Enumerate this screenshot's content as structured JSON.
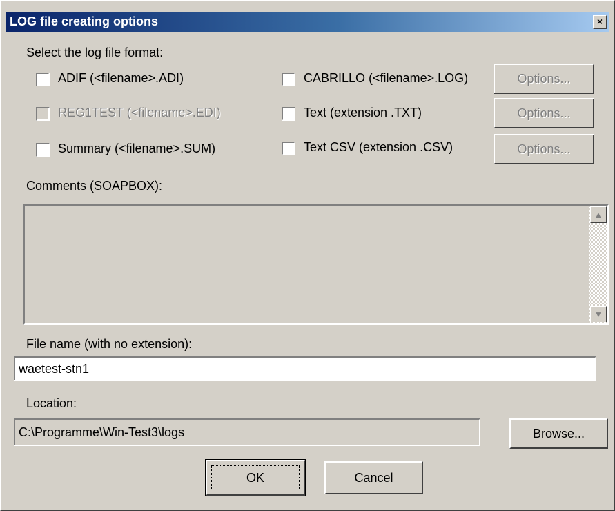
{
  "window": {
    "title": "LOG file creating options",
    "close_glyph": "×"
  },
  "format": {
    "heading": "Select the log file format:",
    "options": [
      {
        "label": "ADIF (<filename>.ADI)",
        "checked": false,
        "enabled": true
      },
      {
        "label": "REG1TEST (<filename>.EDI)",
        "checked": false,
        "enabled": false
      },
      {
        "label": "Summary (<filename>.SUM)",
        "checked": false,
        "enabled": true
      },
      {
        "label": "CABRILLO (<filename>.LOG)",
        "checked": false,
        "enabled": true
      },
      {
        "label": "Text (extension .TXT)",
        "checked": false,
        "enabled": true
      },
      {
        "label": "Text CSV (extension .CSV)",
        "checked": false,
        "enabled": true
      }
    ],
    "options_button_label": "Options..."
  },
  "comments": {
    "label": "Comments (SOAPBOX):",
    "value": ""
  },
  "filename": {
    "label": "File name (with no extension):",
    "value": "waetest-stn1"
  },
  "location": {
    "label": "Location:",
    "value": "C:\\Programme\\Win-Test3\\logs",
    "browse_label": "Browse..."
  },
  "buttons": {
    "ok": "OK",
    "cancel": "Cancel"
  },
  "icons": {
    "close": "close-icon",
    "scroll_up": "scroll-up-arrow-icon",
    "scroll_down": "scroll-down-arrow-icon"
  }
}
